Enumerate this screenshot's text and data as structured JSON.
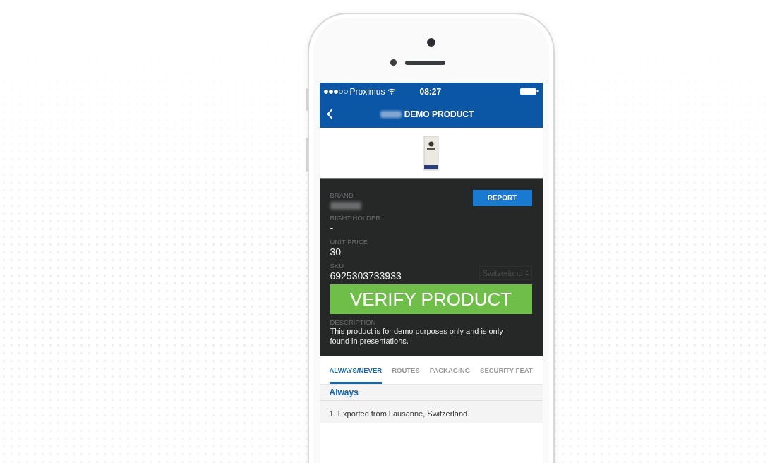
{
  "status_bar": {
    "carrier": "Proximus",
    "time": "08:27"
  },
  "nav_bar": {
    "title": "DEMO PRODUCT"
  },
  "details": {
    "fields": [
      {
        "label": "BRAND",
        "value_blurred": true
      },
      {
        "label": "RIGHT HOLDER",
        "value": "-"
      },
      {
        "label": "UNIT PRICE",
        "value": "30"
      },
      {
        "label": "SKU",
        "value": "6925303733933"
      }
    ],
    "report_button": "REPORT",
    "country_select": "Switzerland",
    "verify_button": "VERIFY PRODUCT",
    "description_label": "DESCRIPTION",
    "description": "This product is for demo purposes only and is only found in presentations."
  },
  "tabs": [
    {
      "label": "ALWAYS/NEVER",
      "selected": true
    },
    {
      "label": "ROUTES",
      "selected": false
    },
    {
      "label": "PACKAGING",
      "selected": false
    },
    {
      "label": "SECURITY FEAT",
      "selected": false
    }
  ],
  "section": {
    "header": "Always",
    "items": [
      "1. Exported from Lausanne, Switzerland."
    ]
  }
}
